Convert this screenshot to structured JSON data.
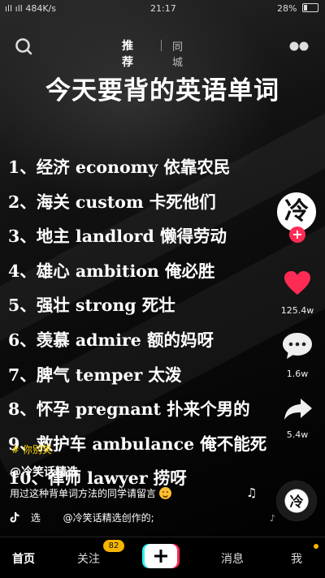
{
  "status_bar": {
    "left": "ıll ıll 484K/s",
    "time": "21:17",
    "battery": "28%"
  },
  "top_bar": {
    "tab_recommend": "推荐",
    "tab_city": "同城"
  },
  "video": {
    "title": "今天要背的英语单词",
    "words": [
      "1、经济 economy 依靠农民",
      "2、海关 custom 卡死他们",
      "3、地主 landlord 懒得劳动",
      "4、雄心 ambition 俺必胜",
      "5、强壮 strong 死壮",
      "6、羡慕 admire 额的妈呀",
      "7、脾气 temper 太泼",
      "8、怀孕 pregnant 扑来个男的",
      "9、救护车 ambulance 俺不能死",
      "10、律师 lawyer 捞呀"
    ]
  },
  "rail": {
    "avatar_char": "冷",
    "likes": "125.4w",
    "comments": "1.6w",
    "shares": "5.4w"
  },
  "caption": {
    "hashtag": "# 你别笑",
    "author": "@冷笑话精选",
    "description": "用过这种背单词方法的同学请留言",
    "music_prefix": "选",
    "music": "@冷笑话精选创作的;",
    "disc_char": "冷"
  },
  "bottom_nav": {
    "home": "首页",
    "follow": "关注",
    "follow_badge": "82",
    "messages": "消息",
    "me": "我"
  },
  "colors": {
    "like": "#fe2c55",
    "badge": "#f5b600",
    "create_cyan": "#25f4ee",
    "create_red": "#fe2c55"
  }
}
